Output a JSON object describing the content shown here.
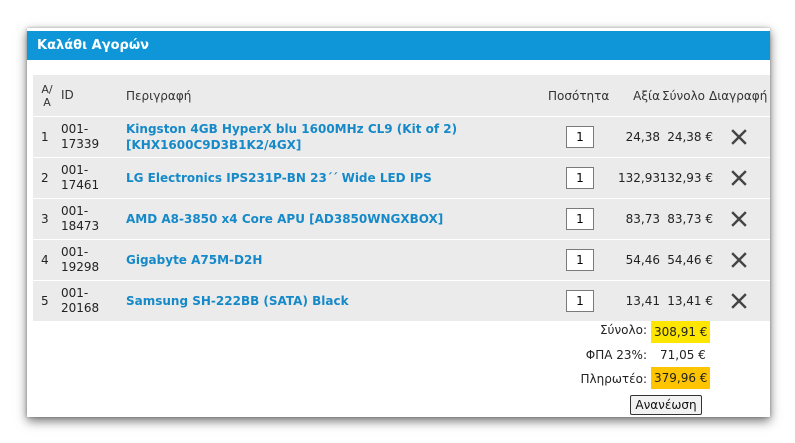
{
  "cart": {
    "title": "Καλάθι Αγορών",
    "columns": {
      "aa": "Α/Α",
      "id": "ID",
      "description": "Περιγραφή",
      "quantity": "Ποσότητα",
      "price": "Αξία",
      "total": "Σύνολο",
      "delete": "Διαγραφή"
    },
    "items": [
      {
        "aa": "1",
        "id_line1": "001-",
        "id_line2": "17339",
        "desc_line1": "Kingston 4GB HyperX blu 1600MHz CL9 (Kit of 2)",
        "desc_line2": "[KHX1600C9D3B1K2/4GX]",
        "qty": "1",
        "price": "24,38",
        "total": "24,38 €"
      },
      {
        "aa": "2",
        "id_line1": "001-",
        "id_line2": "17461",
        "desc_line1": "LG Electronics IPS231P-BN 23΄΄ Wide LED IPS",
        "desc_line2": "",
        "qty": "1",
        "price": "132,93",
        "total": "132,93 €"
      },
      {
        "aa": "3",
        "id_line1": "001-",
        "id_line2": "18473",
        "desc_line1": "AMD A8-3850 x4 Core APU [AD3850WNGXBOX]",
        "desc_line2": "",
        "qty": "1",
        "price": "83,73",
        "total": "83,73 €"
      },
      {
        "aa": "4",
        "id_line1": "001-",
        "id_line2": "19298",
        "desc_line1": "Gigabyte A75M-D2H",
        "desc_line2": "",
        "qty": "1",
        "price": "54,46",
        "total": "54,46 €"
      },
      {
        "aa": "5",
        "id_line1": "001-",
        "id_line2": "20168",
        "desc_line1": "Samsung SH-222BB (SATA) Black",
        "desc_line2": "",
        "qty": "1",
        "price": "13,41",
        "total": "13,41 €"
      }
    ],
    "summary": {
      "subtotal_label": "Σύνολο:",
      "subtotal_value": "308,91 €",
      "vat_label": "ΦΠΑ 23%:",
      "vat_value": "71,05 €",
      "payable_label": "Πληρωτέο:",
      "payable_value": "379,96 €"
    },
    "refresh_label": "Ανανέωση",
    "delete_icon": "close-x-icon"
  }
}
